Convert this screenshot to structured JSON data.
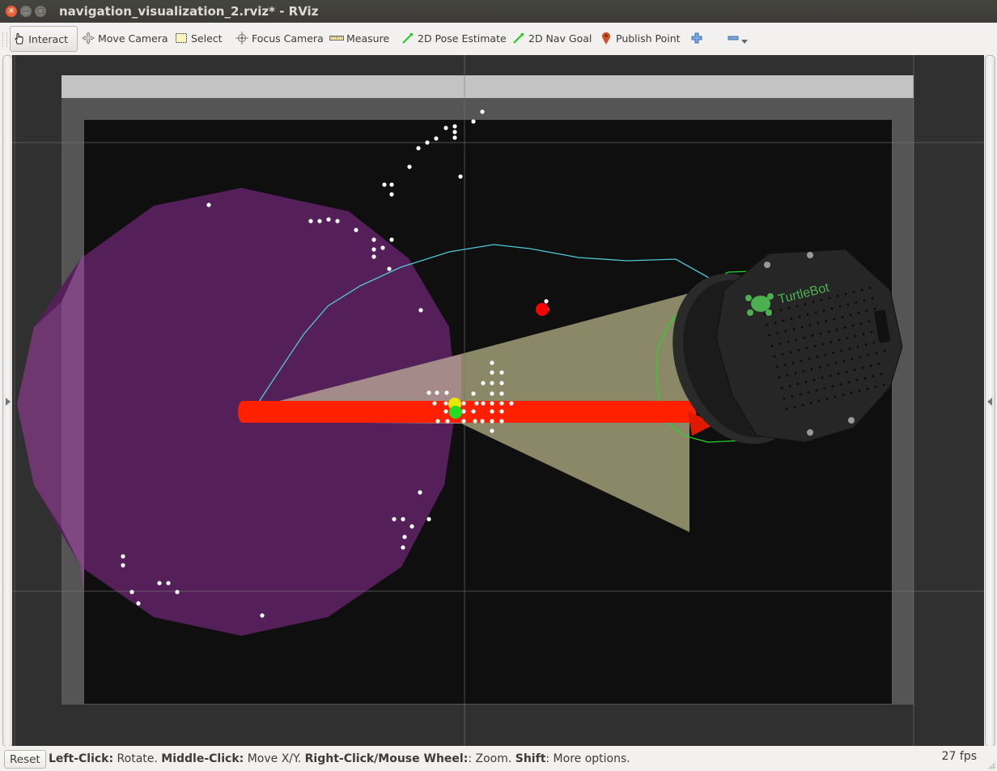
{
  "window": {
    "title": "navigation_visualization_2.rviz* - RViz",
    "controls": [
      "close",
      "minimize",
      "maximize"
    ]
  },
  "toolbar": {
    "tools": [
      {
        "label": "Interact",
        "icon": "hand-pointer-icon",
        "active": true
      },
      {
        "label": "Move Camera",
        "icon": "move-camera-icon",
        "active": false
      },
      {
        "label": "Select",
        "icon": "select-box-icon",
        "active": false
      },
      {
        "label": "Focus Camera",
        "icon": "focus-crosshair-icon",
        "active": false
      },
      {
        "label": "Measure",
        "icon": "ruler-icon",
        "active": false
      },
      {
        "label": "2D Pose Estimate",
        "icon": "green-arrow-icon",
        "active": false
      },
      {
        "label": "2D Nav Goal",
        "icon": "green-arrow-icon",
        "active": false
      },
      {
        "label": "Publish Point",
        "icon": "map-pin-icon",
        "active": false
      }
    ],
    "add_tool": "plus-icon",
    "remove_tool": "minus-icon",
    "dropdown": "dropdown-arrow-icon"
  },
  "viewport": {
    "robot_label": "TurtleBot",
    "robot_trademark": "™",
    "colors": {
      "background": "#303030",
      "map_free": "#0f0f0f",
      "map_unknown": "#555555",
      "map_border": "#c3c3c3",
      "costmap_purple": "#55205a",
      "laser_points": "#ffffff",
      "global_plan": "#4ec9d4",
      "footprint": "#22dd22",
      "pose_arrow": "#ff2000",
      "camera_frustum": "#8a8866",
      "goal_marker": "#ff0000",
      "robot_logo": "#4caf50"
    }
  },
  "statusbar": {
    "reset_label": "Reset",
    "hints": [
      {
        "key": "Left-Click:",
        "text": " Rotate. "
      },
      {
        "key": "Middle-Click:",
        "text": " Move X/Y. "
      },
      {
        "key": "Right-Click/Mouse Wheel:",
        "text": ": Zoom. "
      },
      {
        "key": "Shift",
        "text": ": More options."
      }
    ],
    "fps": "27 fps"
  }
}
